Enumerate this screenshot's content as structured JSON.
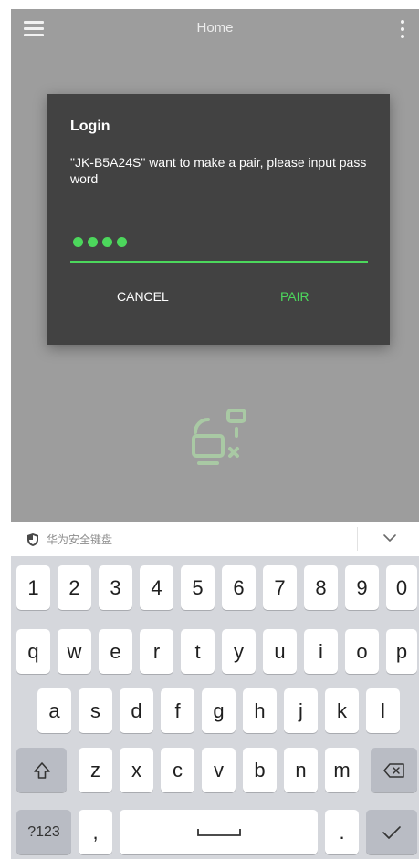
{
  "appbar": {
    "title": "Home",
    "menu_icon": "hamburger-menu-icon",
    "more_icon": "more-vertical-icon"
  },
  "dialog": {
    "title": "Login",
    "message": "\"JK-B5A24S\" want to make a pair, please input password",
    "password_mask": "●●●●",
    "cancel_label": "CANCEL",
    "pair_label": "PAIR"
  },
  "colors": {
    "accent": "#4cd75c",
    "dialog_bg": "#424242",
    "overlay_bg": "#9d9d9d",
    "keyboard_bg": "#d5d7dc"
  },
  "keyboard": {
    "brand_label": "华为安全键盘",
    "brand_icon": "shield-icon",
    "collapse_icon": "chevron-down-icon",
    "row_numbers": [
      "1",
      "2",
      "3",
      "4",
      "5",
      "6",
      "7",
      "8",
      "9",
      "0"
    ],
    "row_1": [
      "q",
      "w",
      "e",
      "r",
      "t",
      "y",
      "u",
      "i",
      "o",
      "p"
    ],
    "row_2": [
      "a",
      "s",
      "d",
      "f",
      "g",
      "h",
      "j",
      "k",
      "l"
    ],
    "row_3": [
      "z",
      "x",
      "c",
      "v",
      "b",
      "n",
      "m"
    ],
    "shift_icon": "shift-icon",
    "backspace_icon": "backspace-icon",
    "symbols_label": "?123",
    "comma_label": ",",
    "space_icon": "space-icon",
    "period_label": ".",
    "enter_icon": "checkmark-icon"
  }
}
